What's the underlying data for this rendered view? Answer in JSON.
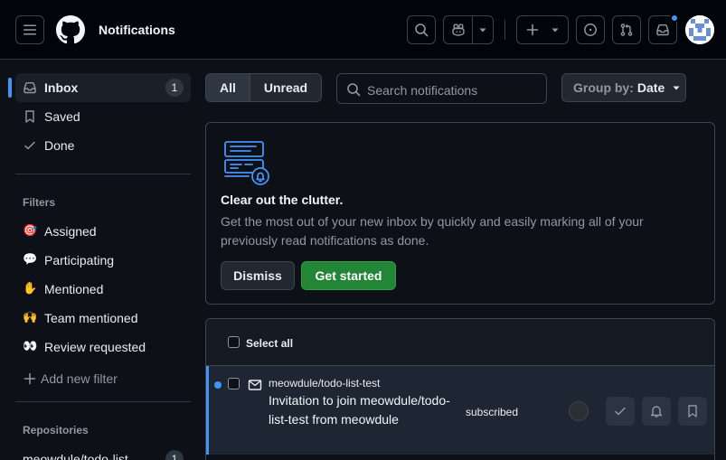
{
  "header": {
    "title": "Notifications",
    "icons": {
      "menu": "hamburger-icon",
      "logo": "github-logo",
      "search": "search-icon",
      "copilot": "copilot-icon",
      "create": "plus-icon",
      "issues": "issue-opened-icon",
      "pulls": "git-pull-request-icon",
      "inbox": "inbox-icon"
    }
  },
  "sidebar": {
    "inbox": {
      "label": "Inbox",
      "count": "1"
    },
    "saved": {
      "label": "Saved"
    },
    "done": {
      "label": "Done"
    },
    "filters_heading": "Filters",
    "filters": [
      {
        "emoji": "🎯",
        "label": "Assigned"
      },
      {
        "emoji": "💬",
        "label": "Participating"
      },
      {
        "emoji": "✋",
        "label": "Mentioned"
      },
      {
        "emoji": "🙌",
        "label": "Team mentioned"
      },
      {
        "emoji": "👀",
        "label": "Review requested"
      }
    ],
    "add_filter": "Add new filter",
    "repositories_heading": "Repositories",
    "repositories": [
      {
        "label": "meowdule/todo-list",
        "count": "1"
      }
    ]
  },
  "toolbar": {
    "all": "All",
    "unread": "Unread",
    "search_placeholder": "Search notifications",
    "group_by_label": "Group by:",
    "group_by_value": "Date"
  },
  "banner": {
    "title": "Clear out the clutter.",
    "text": "Get the most out of your new inbox by quickly and easily marking all of your previously read notifications as done.",
    "dismiss": "Dismiss",
    "get_started": "Get started"
  },
  "list": {
    "select_all": "Select all",
    "rows": [
      {
        "repo": "meowdule/todo-list-test",
        "title": "Invitation to join meowdule/todo-list-test from meowdule",
        "reason": "subscribed"
      }
    ]
  },
  "colors": {
    "accent": "#4493f8",
    "primary_button": "#238636",
    "background": "#0d1117",
    "header_bg": "#010409"
  }
}
